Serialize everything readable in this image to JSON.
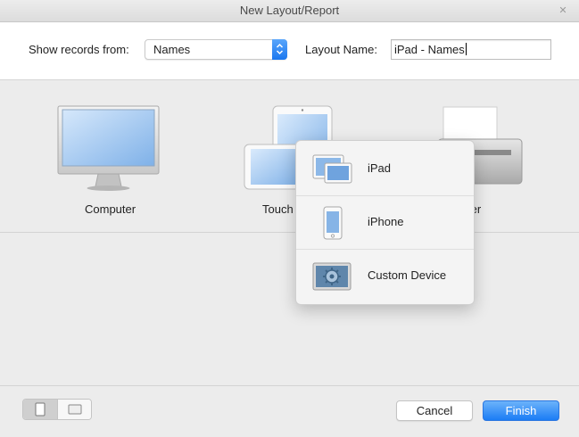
{
  "window": {
    "title": "New Layout/Report"
  },
  "header": {
    "show_records_label": "Show records from:",
    "table_value": "Names",
    "layout_name_label": "Layout Name:",
    "layout_name_value": "iPad - Names"
  },
  "devices": [
    {
      "label": "Computer",
      "icon": "computer-icon"
    },
    {
      "label": "Touch",
      "icon": "touch-device-icon"
    },
    {
      "label": "ter",
      "icon": "printer-icon"
    }
  ],
  "popup_menu": {
    "items": [
      {
        "label": "iPad",
        "icon": "ipad-icon"
      },
      {
        "label": "iPhone",
        "icon": "iphone-icon"
      },
      {
        "label": "Custom Device",
        "icon": "custom-device-icon"
      }
    ]
  },
  "footer": {
    "cancel_label": "Cancel",
    "finish_label": "Finish",
    "accent": "#1b7cf5"
  }
}
